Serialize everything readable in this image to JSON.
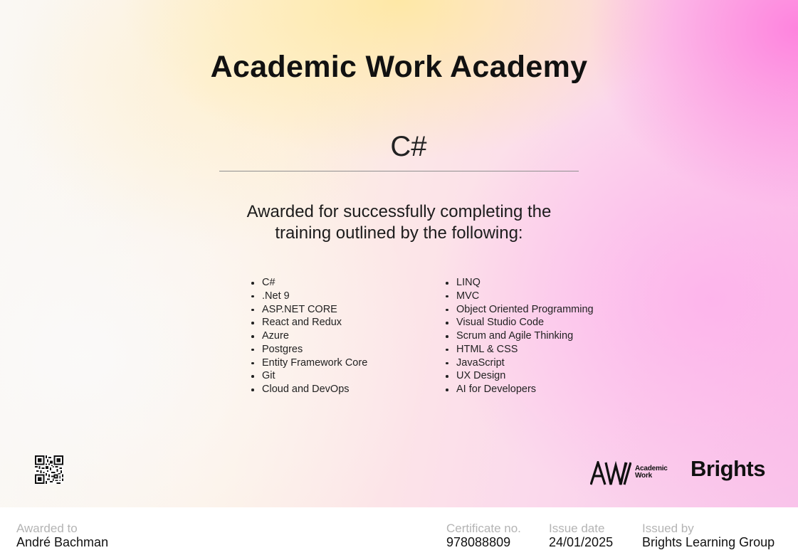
{
  "certificate": {
    "organization": "Academic Work Academy",
    "course": "C#",
    "awarded_text": [
      "Awarded for successfully completing the",
      "training outlined by the following:"
    ],
    "topics_left": [
      "C#",
      ".Net 9",
      "ASP.NET CORE",
      "React and Redux",
      "Azure",
      "Postgres",
      "Entity Framework Core",
      "Git",
      "Cloud and DevOps"
    ],
    "topics_right": [
      "LINQ",
      "MVC",
      "Object Oriented Programming",
      "Visual Studio Code",
      "Scrum and Agile Thinking",
      " HTML & CSS",
      "JavaScript",
      "UX Design",
      "AI for Developers"
    ],
    "logos": {
      "academic_work_line1": "Academic",
      "academic_work_line2": "Work",
      "brights": "Brights"
    },
    "icons": [
      "qr-code-icon",
      "academic-work-logo-icon"
    ]
  },
  "footer": {
    "awarded_to_label": "Awarded to",
    "awarded_to_value": "André Bachman",
    "certificate_no_label": "Certificate no.",
    "certificate_no_value": "978088809",
    "issue_date_label": "Issue date",
    "issue_date_value": "24/01/2025",
    "issued_by_label": "Issued by",
    "issued_by_value": "Brights Learning Group"
  },
  "colors": {
    "accent_pink": "#f9c3ea",
    "accent_yellow": "#ffe896",
    "text": "#111111",
    "label_gray": "#b4b4b4"
  }
}
